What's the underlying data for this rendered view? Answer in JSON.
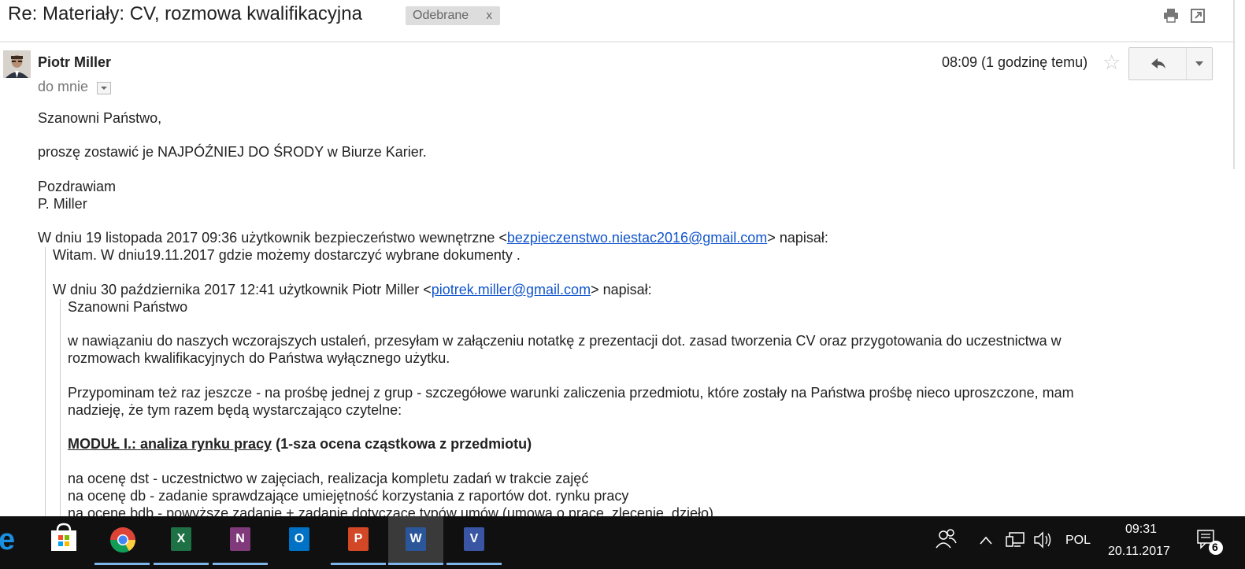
{
  "email": {
    "subject": "Re: Materiały: CV, rozmowa kwalifikacyjna",
    "label": "Odebrane",
    "label_remove": "x",
    "sender": "Piotr Miller",
    "to": "do mnie",
    "time": "08:09 (1 godzinę temu)",
    "body": {
      "l1": "Szanowni Państwo,",
      "l2": "proszę zostawić je NAJPÓŹNIEJ DO ŚRODY w Biurze Karier.",
      "l3": "Pozdrawiam",
      "l4": "P. Miller",
      "q1_prefix": "W dniu 19 listopada 2017 09:36 użytkownik bezpieczeństwo wewnętrzne <",
      "q1_email": "bezpieczenstwo.niestac2016@gmail.com",
      "q1_suffix": "> napisał:",
      "q1_text": "Witam. W dniu19.11.2017  gdzie możemy dostarczyć wybrane dokumenty .",
      "q2_prefix": "W dniu 30 października 2017 12:41 użytkownik Piotr Miller <",
      "q2_email": "piotrek.miller@gmail.com",
      "q2_suffix": "> napisał:",
      "q2_l1": "Szanowni Państwo",
      "q2_l2": "w nawiązaniu do naszych wczorajszych ustaleń, przesyłam w załączeniu notatkę z prezentacji dot. zasad tworzenia CV oraz przygotowania do uczestnictwa w",
      "q2_l3": "rozmowach kwalifikacyjnych do Państwa wyłącznego użytku.",
      "q2_l4": "Przypominam też raz jeszcze - na prośbę jednej z grup - szczegółowe warunki zaliczenia przedmiotu, które zostały na Państwa prośbę nieco uproszczone, mam",
      "q2_l5": "nadzieję, że tym razem będą wystarczająco czytelne:",
      "module_title": "MODUŁ I.: analiza rynku pracy",
      "module_rest": " (1-sza ocena cząstkowa z przedmiotu)",
      "g1": "na ocenę dst - uczestnictwo w zajęciach, realizacja kompletu zadań w trakcie zajęć",
      "g2": "na ocenę db - zadanie sprawdzające umiejętność korzystania z raportów dot. rynku pracy",
      "g3": "na ocenę bdb - powyższe zadanie + zadanie dotyczące typów umów (umowa o pracę, zlecenie, dzieło)"
    }
  },
  "taskbar": {
    "apps": [
      "edge-icon",
      "store-icon",
      "chrome-icon",
      "excel-icon",
      "onenote-icon",
      "outlook-icon",
      "powerpoint-icon",
      "word-icon",
      "visio-icon"
    ],
    "language": "POL",
    "time": "09:31",
    "date": "20.11.2017",
    "notifications": "6",
    "colors": {
      "excel": "#1e7145",
      "onenote": "#80397b",
      "outlook": "#0072c6",
      "powerpoint": "#d24726",
      "word": "#2b579a",
      "visio": "#3955a3"
    }
  }
}
